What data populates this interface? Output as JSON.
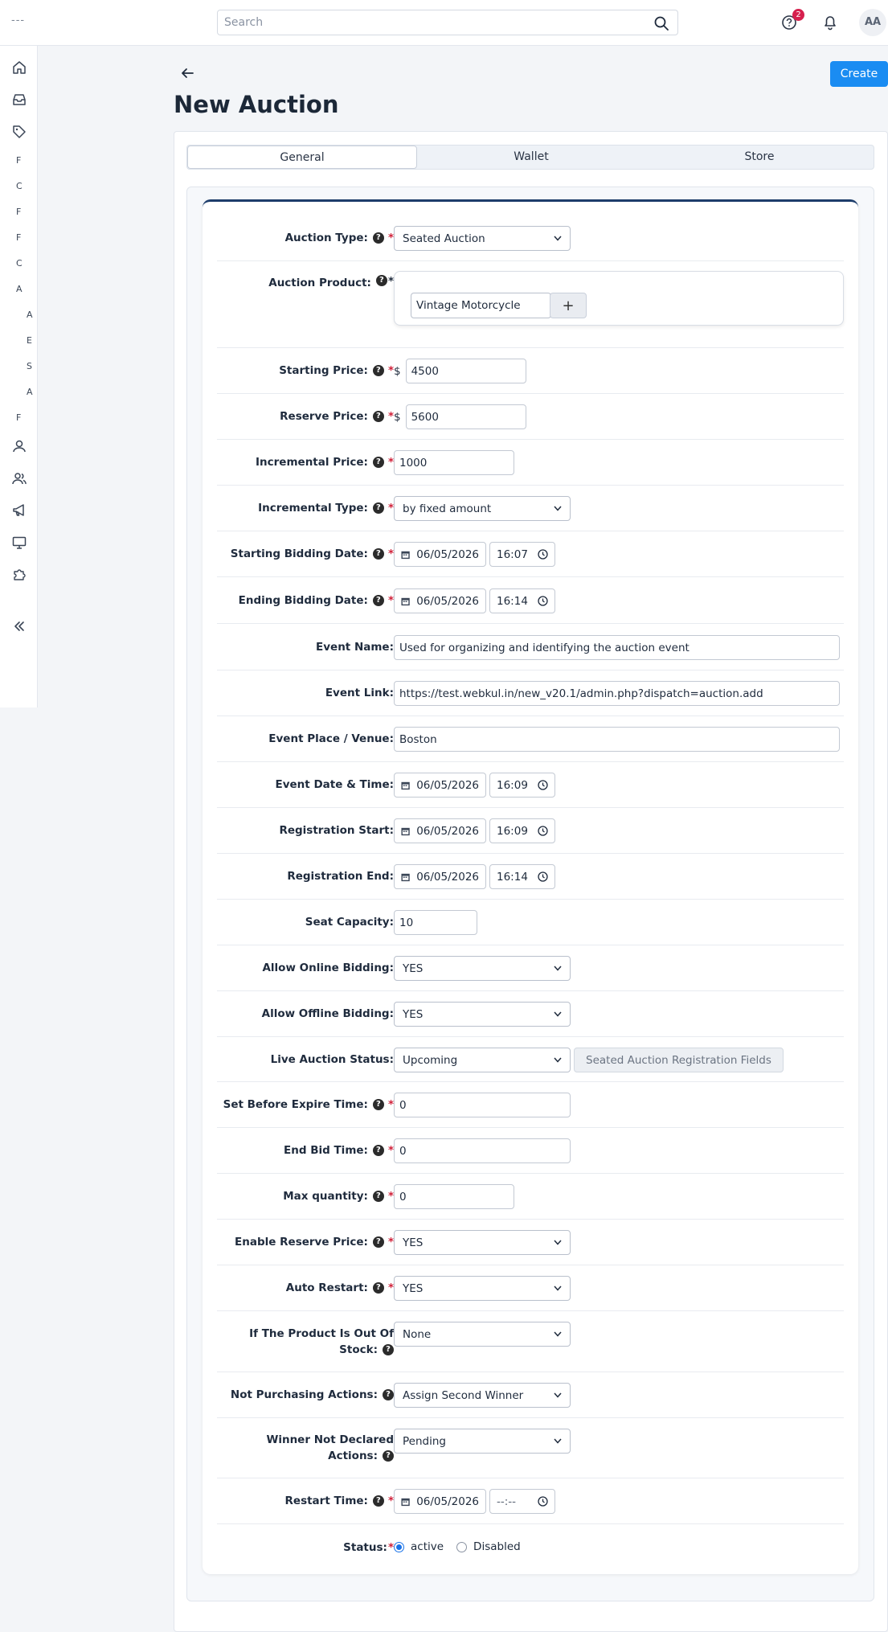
{
  "topbar": {
    "menu_text": "---",
    "search_placeholder": "Search",
    "notifications_count": "2",
    "avatar_initials": "AA"
  },
  "sidebar": {
    "letters": [
      "F",
      "C",
      "F",
      "F",
      "C",
      "A",
      "A",
      "E",
      "S",
      "A",
      "F"
    ]
  },
  "page": {
    "title": "New Auction",
    "create_label": "Create"
  },
  "tabs": [
    "General",
    "Wallet",
    "Store"
  ],
  "form": {
    "auction_type": {
      "label": "Auction Type:",
      "value": "Seated Auction"
    },
    "auction_product": {
      "label": "Auction Product:",
      "value": "Vintage Motorcycle",
      "add": "+"
    },
    "starting_price": {
      "label": "Starting Price:",
      "currency": "$",
      "value": "4500"
    },
    "reserve_price": {
      "label": "Reserve Price:",
      "currency": "$",
      "value": "5600"
    },
    "incremental_price": {
      "label": "Incremental Price:",
      "value": "1000"
    },
    "incremental_type": {
      "label": "Incremental Type:",
      "value": "by fixed amount"
    },
    "starting_bidding_date": {
      "label": "Starting Bidding Date:",
      "date": "06/05/2026",
      "time": "16:07"
    },
    "ending_bidding_date": {
      "label": "Ending Bidding Date:",
      "date": "06/05/2026",
      "time": "16:14"
    },
    "event_name": {
      "label": "Event Name:",
      "value": "Used for organizing and identifying the auction event"
    },
    "event_link": {
      "label": "Event Link:",
      "value": "https://test.webkul.in/new_v20.1/admin.php?dispatch=auction.add"
    },
    "event_place": {
      "label": "Event Place / Venue:",
      "value": "Boston"
    },
    "event_datetime": {
      "label": "Event Date & Time:",
      "date": "06/05/2026",
      "time": "16:09"
    },
    "registration_start": {
      "label": "Registration Start:",
      "date": "06/05/2026",
      "time": "16:09"
    },
    "registration_end": {
      "label": "Registration End:",
      "date": "06/05/2026",
      "time": "16:14"
    },
    "seat_capacity": {
      "label": "Seat Capacity:",
      "value": "10"
    },
    "allow_online": {
      "label": "Allow Online Bidding:",
      "value": "YES"
    },
    "allow_offline": {
      "label": "Allow Offline Bidding:",
      "value": "YES"
    },
    "live_status": {
      "label": "Live Auction Status:",
      "value": "Upcoming",
      "button": "Seated Auction Registration Fields"
    },
    "before_expire": {
      "label": "Set Before Expire Time:",
      "value": "0"
    },
    "end_bid_time": {
      "label": "End Bid Time:",
      "value": "0"
    },
    "max_quantity": {
      "label": "Max quantity:",
      "value": "0"
    },
    "enable_reserve": {
      "label": "Enable Reserve Price:",
      "value": "YES"
    },
    "auto_restart": {
      "label": "Auto Restart:",
      "value": "YES"
    },
    "out_of_stock": {
      "label_line1": "If The Product Is Out Of",
      "label_line2": "Stock:",
      "value": "None"
    },
    "not_purchasing": {
      "label": "Not Purchasing Actions:",
      "value": "Assign Second Winner"
    },
    "winner_not_declared": {
      "label_line1": "Winner Not Declared",
      "label_line2": "Actions:",
      "value": "Pending"
    },
    "restart_time": {
      "label": "Restart Time:",
      "date": "06/05/2026",
      "time": "--:--"
    },
    "status": {
      "label": "Status:",
      "options": [
        "active",
        "Disabled"
      ],
      "selected": "active"
    }
  },
  "help_glyph": "?",
  "required_mark": "*",
  "colors": {
    "primary": "#1a8cf2",
    "required": "#d0213a",
    "card_border": "#1d3d6b"
  }
}
